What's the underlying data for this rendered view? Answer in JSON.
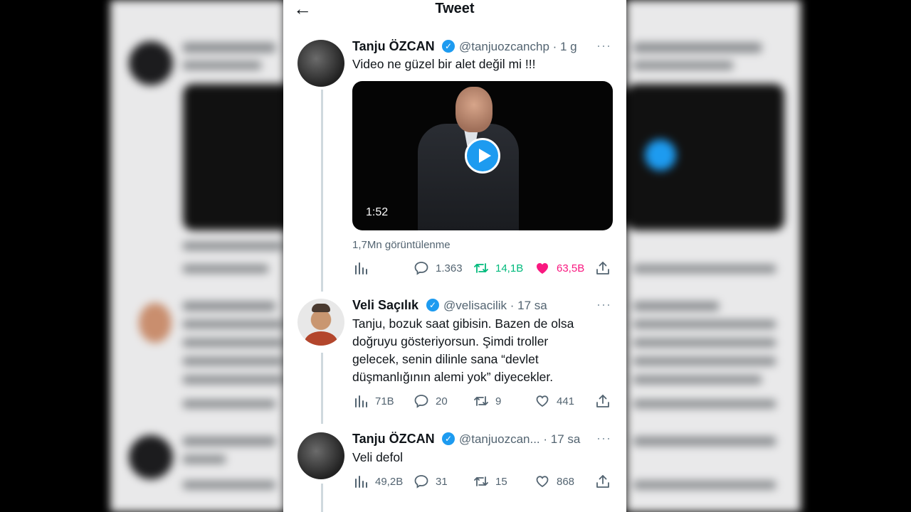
{
  "header": {
    "back_label": "←",
    "title": "Tweet"
  },
  "tweets": [
    {
      "author": "Tanju ÖZCAN",
      "verified_icon": "✓",
      "handle_time": "@tanjuozcanchp · 1 g",
      "more": "···",
      "text": "Video ne güzel bir alet değil mi !!!",
      "video_duration": "1:52",
      "views": "1,7Mn görüntülenme",
      "stats": {
        "replies": "1.363",
        "retweets": "14,1B",
        "likes": "63,5B"
      },
      "retweet_color": "#00ba7c",
      "like_color": "#f91880"
    },
    {
      "author": "Veli Saçılık",
      "verified_icon": "✓",
      "handle_time": "@velisacilik · 17 sa",
      "more": "···",
      "text_lines": [
        "Tanju, bozuk saat gibisin. Bazen de olsa",
        "doğruyu gösteriyorsun. Şimdi troller",
        "gelecek, senin dilinle sana “devlet",
        "düşmanlığının alemi yok” diyecekler."
      ],
      "stats": {
        "views": "71B",
        "replies": "20",
        "retweets": "9",
        "likes": "441"
      }
    },
    {
      "author": "Tanju ÖZCAN",
      "verified_icon": "✓",
      "handle_time": "@tanjuozcan... · 17 sa",
      "more": "···",
      "text": "Veli defol",
      "stats": {
        "views": "49,2B",
        "replies": "31",
        "retweets": "15",
        "likes": "868"
      }
    }
  ],
  "accent_color": "#1d9bf0"
}
